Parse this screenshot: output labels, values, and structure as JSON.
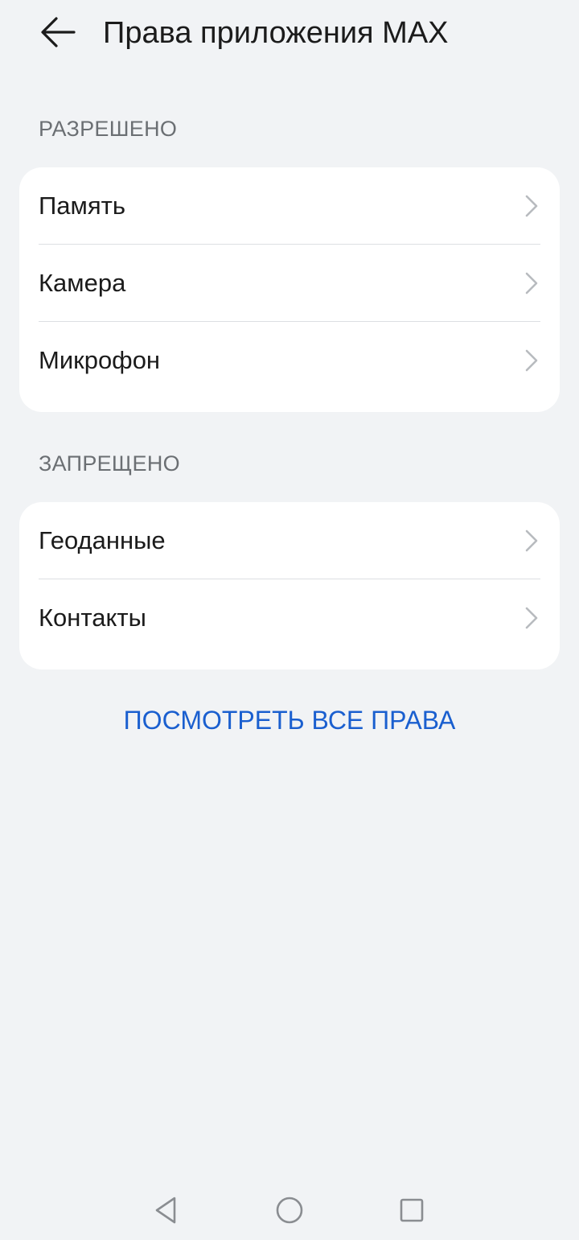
{
  "header": {
    "back_icon": "arrow-left-icon",
    "title": "Права приложения MAX"
  },
  "allowed": {
    "label": "РАЗРЕШЕНО",
    "items": [
      {
        "label": "Память",
        "icon": "chevron-right-icon"
      },
      {
        "label": "Камера",
        "icon": "chevron-right-icon"
      },
      {
        "label": "Микрофон",
        "icon": "chevron-right-icon"
      }
    ]
  },
  "denied": {
    "label": "ЗАПРЕЩЕНО",
    "items": [
      {
        "label": "Геоданные",
        "icon": "chevron-right-icon"
      },
      {
        "label": "Контакты",
        "icon": "chevron-right-icon"
      }
    ]
  },
  "view_all": {
    "label": "ПОСМОТРЕТЬ ВСЕ ПРАВА"
  },
  "nav": {
    "back": "triangle-back-icon",
    "home": "circle-home-icon",
    "recents": "square-recents-icon"
  },
  "colors": {
    "background": "#f1f3f5",
    "card": "#ffffff",
    "accent": "#1a5fcf",
    "section_label": "#6b6f73"
  }
}
